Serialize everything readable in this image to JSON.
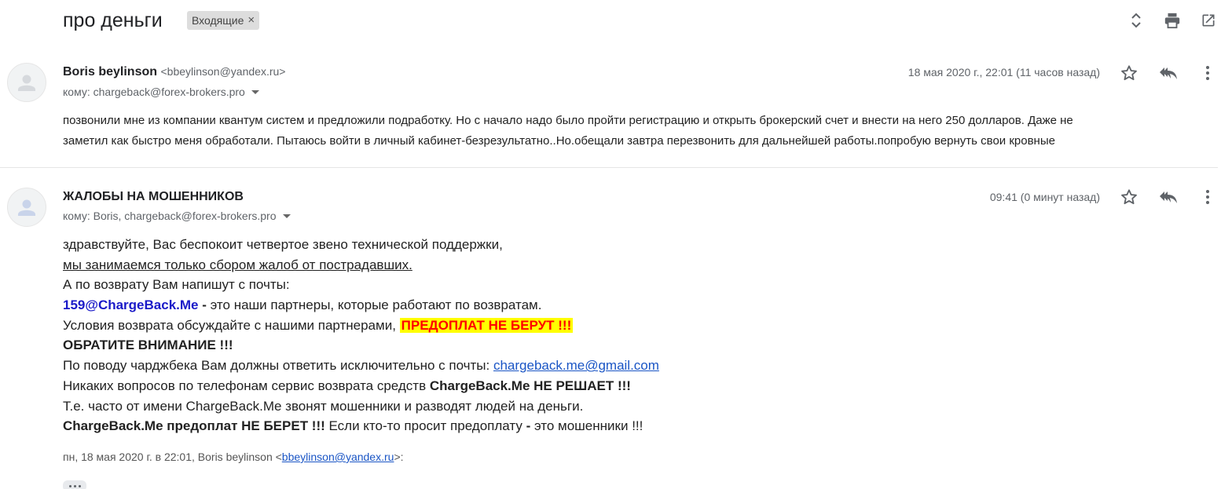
{
  "thread": {
    "subject": "про деньги",
    "label": "Входящие",
    "label_close": "×"
  },
  "toolbar": {
    "icons": [
      "expand-collapse-icon",
      "print-icon",
      "open-in-new-window-icon"
    ]
  },
  "messages": [
    {
      "sender_name": "Boris beylinson",
      "sender_email": "<bbeylinson@yandex.ru>",
      "to": "кому: chargeback@forex-brokers.pro",
      "date": "18 мая 2020 г., 22:01 (11 часов назад)",
      "body_lines": [
        "позвонили мне из компании квантум систем и предложили подработку. Но с начало надо было пройти регистрацию  и открыть брокерский счет  и внести на него 250 долларов.  Даже не",
        "заметил как быстро меня обработали. Пытаюсь войти в личный кабинет-безрезультатно..Но.обещали завтра перезвонить для дальнейшей работы.попробую вернуть свои кровные"
      ]
    },
    {
      "sender_name": "ЖАЛОБЫ НА МОШЕННИКОВ",
      "to": "кому: Boris, chargeback@forex-brokers.pro",
      "date": "09:41 (0 минут назад)",
      "body": {
        "l1": "здравствуйте, Вас беспокоит четвертое звено технической поддержки,",
        "l2": "мы занимаемся только сбором жалоб от пострадавших.",
        "l3": "А по возврату Вам напишут с почты:",
        "l4_email": "159@ChargeBack.Me",
        "l4_dash": " -",
        "l4_rest": " это наши партнеры, которые работают по возвратам.",
        "l5_text": "Условия возврата обсуждайте с нашими партнерами, ",
        "l5_warn": "ПРЕДОПЛАТ НЕ БЕРУТ !!!",
        "l6": "ОБРАТИТЕ ВНИМАНИЕ !!!",
        "l7_text": "По поводу чарджбека Вам должны ответить исключительно с почты: ",
        "l7_link": "chargeback.me@gmail.com",
        "l8_text": "Никаких вопросов по телефонам сервис возврата средств ",
        "l8_bold": "ChargeBack.Me НЕ РЕШАЕТ !!!",
        "l9": "Т.е. часто от имени ChargeBack.Me звонят мошенники и разводят людей на деньги.",
        "l10_bold": "ChargeBack.Me предоплат НЕ БЕРЕТ !!!",
        "l10_text": " Если кто-то просит предоплату ",
        "l10_dash": "-",
        "l10_end": " это мошенники !!!"
      },
      "quote_attr_prefix": "пн, 18 мая 2020 г. в 22:01, Boris beylinson <",
      "quote_attr_email": "bbeylinson@yandex.ru",
      "quote_attr_suffix": ">:"
    }
  ],
  "icons": {
    "star": "star-icon",
    "reply": "reply-all-icon",
    "more": "more-vert-icon",
    "avatar": "person-icon"
  },
  "colors": {
    "warning_bg": "#ffff00",
    "warning_text": "#ff0000",
    "partner_email": "#1a1ac8",
    "link": "#1a55c5"
  }
}
